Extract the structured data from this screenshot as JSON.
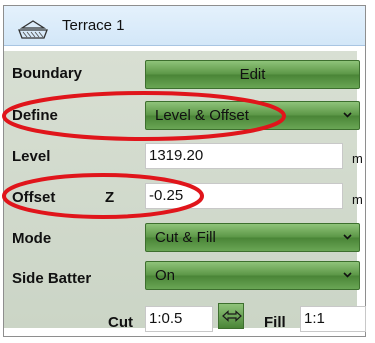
{
  "panel": {
    "title": "Terrace 1",
    "title_icon": "terrace-icon"
  },
  "rows": {
    "boundary": {
      "label": "Boundary",
      "button": "Edit"
    },
    "define": {
      "label": "Define",
      "value": "Level & Offset"
    },
    "level": {
      "label": "Level",
      "value": "1319.20",
      "unit": "m"
    },
    "offset": {
      "label": "Offset",
      "axis": "Z",
      "value": "-0.25",
      "unit": "m"
    },
    "mode": {
      "label": "Mode",
      "value": "Cut & Fill"
    },
    "side_batter": {
      "label": "Side Batter",
      "value": "On"
    },
    "slopes": {
      "cut_label": "Cut",
      "cut_value": "1:0.5",
      "fill_label": "Fill",
      "fill_value": "1:1"
    }
  },
  "colors": {
    "accent_green": "#5c9747",
    "highlight_red": "#e0151b",
    "header_blue": "#d3e7f8"
  }
}
